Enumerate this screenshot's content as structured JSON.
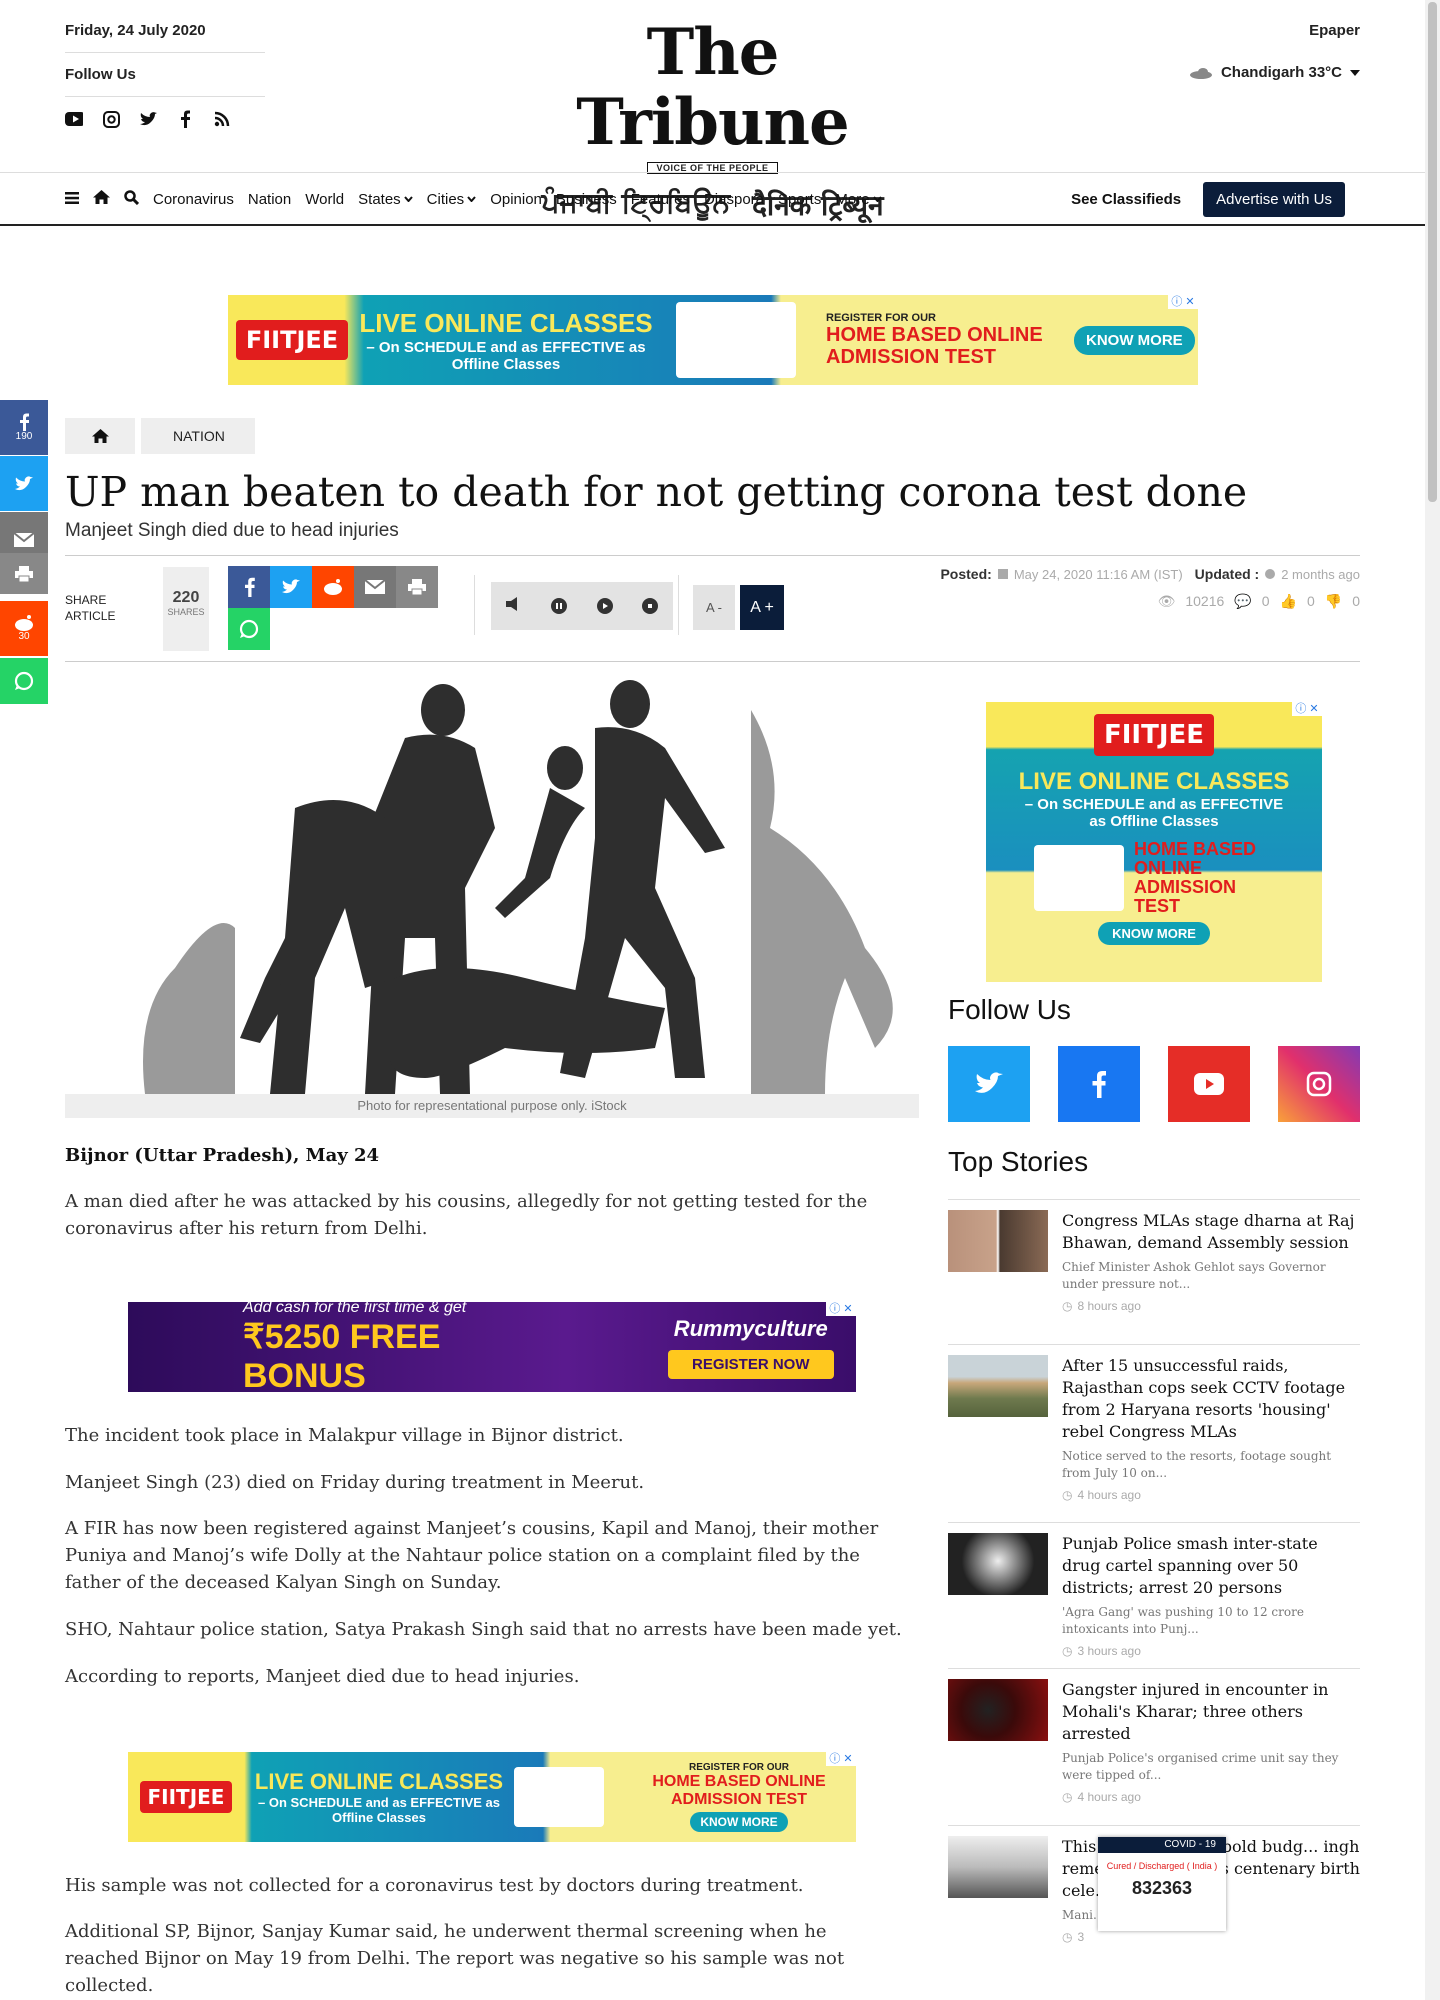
{
  "header": {
    "date": "Friday, 24 July 2020",
    "follow_us": "Follow Us",
    "logo_title": "The Tribune",
    "logo_tagline": "VOICE OF THE PEOPLE",
    "logo_punjabi": "ਪੰਜਾਬੀ ਟ੍ਰਿਬਿਊਨ",
    "logo_hindi": "दैनिक ट्रिब्यून",
    "epaper": "Epaper",
    "weather": "Chandigarh 33°C"
  },
  "nav": {
    "items": [
      "Coronavirus",
      "Nation",
      "World",
      "States",
      "Cities",
      "Opinion",
      "Business",
      "Features",
      "Diaspora",
      "Sports",
      "More"
    ],
    "see_classifieds": "See Classifieds",
    "advertise": "Advertise with Us"
  },
  "ads": {
    "fiitjee_brand": "FIITJEE",
    "fiitjee_headline": "LIVE ONLINE CLASSES",
    "fiitjee_sub": "– On SCHEDULE and as EFFECTIVE as Offline Classes",
    "fiitjee_register": "REGISTER FOR OUR",
    "fiitjee_test": "HOME BASED ONLINE ADMISSION TEST",
    "fiitjee_cta": "KNOW MORE",
    "rummy_line1": "Add cash for the first time & get",
    "rummy_bonus": "₹5250 FREE BONUS",
    "rummy_brand": "Rummyculture",
    "rummy_cta": "REGISTER NOW"
  },
  "share_rail": {
    "facebook_count": "190",
    "reddit_count": "30"
  },
  "breadcrumb": {
    "section": "NATION"
  },
  "article": {
    "headline": "UP man beaten to death for not getting corona test done",
    "subhead": "Manjeet Singh died due to head injuries",
    "share_label_1": "SHARE",
    "share_label_2": "ARTICLE",
    "share_count": "220",
    "share_count_label": "SHARES",
    "font_minus": "A -",
    "font_plus": "A +",
    "posted_label": "Posted:",
    "posted_date": "May 24, 2020 11:16 AM (IST)",
    "updated_label": "Updated :",
    "updated_ago": "2 months ago",
    "views": "10216",
    "comments": "0",
    "likes": "0",
    "dislikes": "0",
    "image_caption": "Photo for representational purpose only. iStock",
    "dateline": "Bijnor (Uttar Pradesh), May 24",
    "p1": "A man died after he was attacked by his cousins, allegedly for not getting tested for the coronavirus after his return from Delhi.",
    "p2": "The incident took place in Malakpur village in Bijnor district.",
    "p3": "Manjeet Singh (23) died on Friday during treatment in Meerut.",
    "p4": "A FIR has now been registered against Manjeet’s cousins, Kapil and Manoj, their mother Puniya and Manoj’s wife Dolly at the Nahtaur police station on a complaint filed by the father of the deceased Kalyan Singh on Sunday.",
    "p5": "SHO, Nahtaur police station, Satya Prakash Singh said that no arrests have been made yet.",
    "p6": "According to reports, Manjeet died due to head injuries.",
    "p7": "His sample was not collected for a coronavirus test by doctors during treatment.",
    "p8": "Additional SP, Bijnor, Sanjay Kumar said, he underwent thermal screening when he reached Bijnor on May 19 from Delhi. The report was negative so his sample was not collected."
  },
  "sidebar": {
    "follow_us": "Follow Us",
    "top_stories": "Top Stories",
    "stories": [
      {
        "title": "Congress MLAs stage dharna at Raj Bhawan, demand Assembly session",
        "desc": "Chief Minister Ashok Gehlot says Governor under pressure not...",
        "time": "8 hours ago"
      },
      {
        "title": "After 15 unsuccessful raids, Rajasthan cops seek CCTV footage from 2 Haryana resorts 'housing' rebel Congress MLAs",
        "desc": "Notice served to the resorts, footage sought from July 10 on...",
        "time": "4 hours ago"
      },
      {
        "title": "Punjab Police smash inter-state drug cartel spanning over 50 districts; arrest 20 persons",
        "desc": "'Agra Gang' was pushing 10 to 12 crore intoxicants into Punj...",
        "time": "3 hours ago"
      },
      {
        "title": "Gangster injured in encounter in Mohali's Kharar; three others arrested",
        "desc": "Punjab Police's organised crime unit say they were tipped of...",
        "time": "4 hours ago"
      },
      {
        "title": "This ... esented the bold budg... ingh remembers Nara... s centenary birth cele...",
        "desc": "Mani... mem...",
        "time": "3"
      }
    ]
  },
  "covid_widget": {
    "title": "COVID - 19",
    "label": "Cured / Discharged ( India )",
    "count": "832363"
  }
}
